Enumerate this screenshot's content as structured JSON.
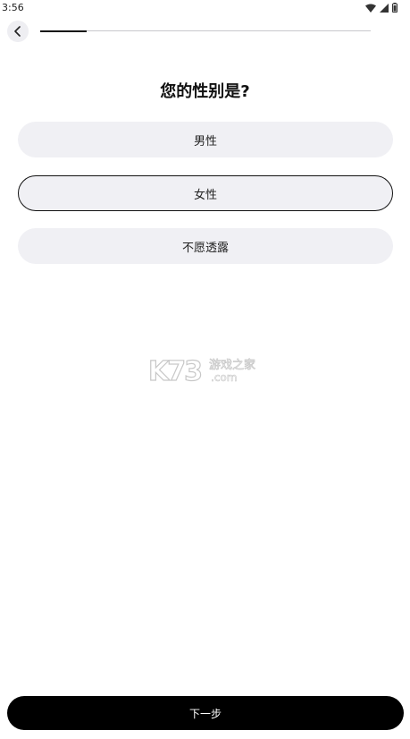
{
  "status_bar": {
    "time": "3:56",
    "icons": [
      "wifi-icon",
      "signal-icon",
      "battery-icon"
    ]
  },
  "nav": {
    "back_icon": "chevron-left-icon",
    "progress_fraction": 0.14
  },
  "question": {
    "title": "您的性别是?"
  },
  "options": [
    {
      "label": "男性",
      "selected": false
    },
    {
      "label": "女性",
      "selected": true
    },
    {
      "label": "不愿透露",
      "selected": false
    }
  ],
  "watermark": {
    "logo_text": "K73",
    "site_text": "游戏之家",
    "domain_text": ".com"
  },
  "footer": {
    "next_label": "下一步"
  },
  "colors": {
    "option_bg": "#f0f0f4",
    "selected_border": "#111111",
    "primary_button_bg": "#000000",
    "primary_button_text": "#ffffff"
  }
}
